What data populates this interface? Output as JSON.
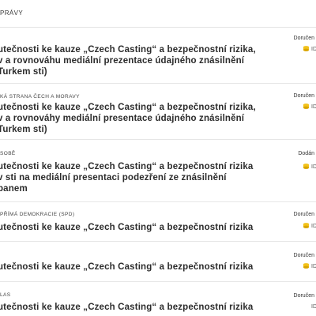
{
  "header": {
    "label": "PRÁVY"
  },
  "rows": [
    {
      "org": "",
      "title": "utečnosti ke kauze „Czech Casting“ a bezpečnostní rizika, v a rovnováhu mediální prezentace údajného znásilnění Turkem sti)",
      "status": "Doručen",
      "id": "ID"
    },
    {
      "org": "KÁ STRANA ČECH A MORAVY",
      "title": "utečnosti ke kauze „Czech Casting“ a bezpečnostní rizika, v a rovnováhy mediální presentace údajného znásilnění Turkem sti)",
      "status": "Doručen",
      "id": "ID"
    },
    {
      "org": "SOBĚ",
      "title": "utečnosti ke kauze „Czech Casting“ a bezpečnostní rizika v sti na mediální presentaci podezření ze znásilnění panem",
      "status": "Dodán",
      "id": "ID"
    },
    {
      "org": "PŘÍMÁ DEMOKRACIE (SPD)",
      "title": "utečnosti ke kauze „Czech Casting“ a bezpečnostní rizika",
      "status": "Doručen",
      "id": "ID"
    },
    {
      "org": "",
      "title": "utečnosti ke kauze „Czech Casting“ a bezpečnostní rizika",
      "status": "Doručen",
      "id": "ID"
    },
    {
      "org": "LAS",
      "title": "utečnosti ke kauze „Czech Casting“ a bezpečnostní rizika",
      "status": "Doručen",
      "id": "ID"
    }
  ],
  "colors": {
    "coin": "#f2c21b",
    "coin_dark": "#d9a400"
  }
}
